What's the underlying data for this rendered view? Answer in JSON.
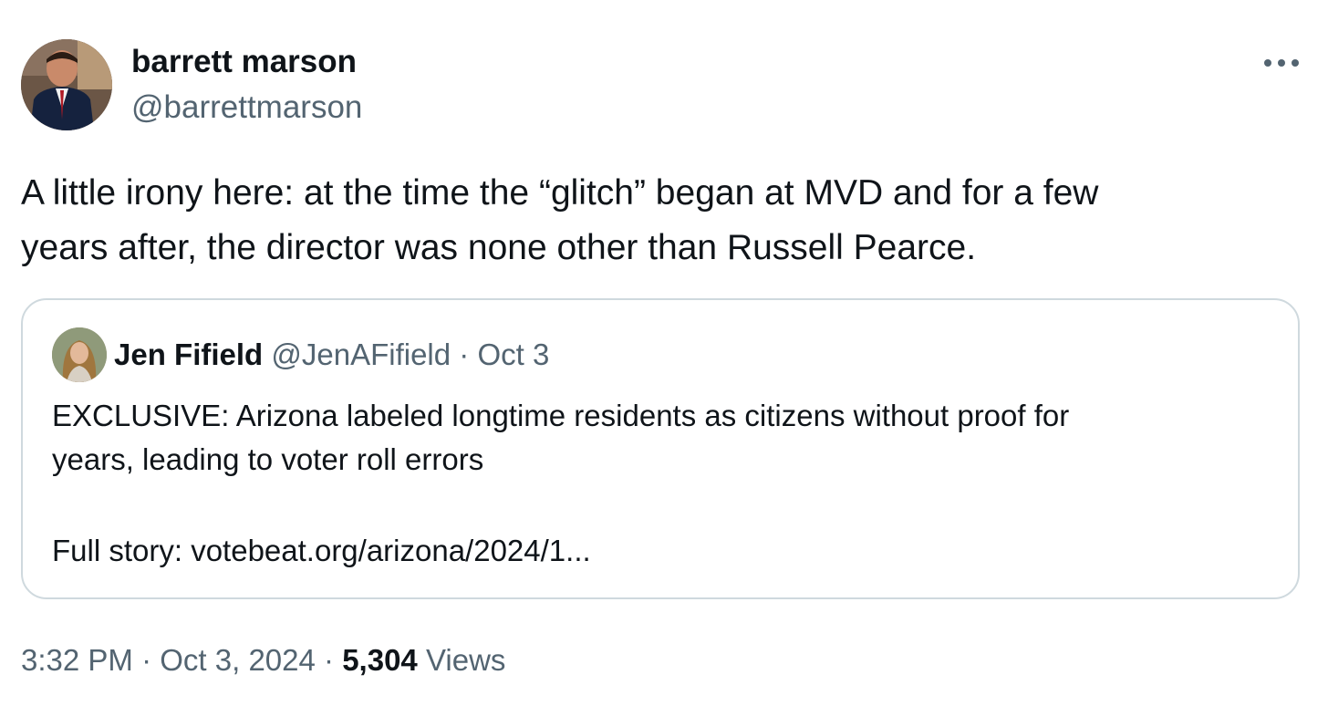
{
  "author": {
    "name": "barrett marson",
    "handle": "@barrettmarson",
    "avatar_icon": "profile-photo-man-in-suit"
  },
  "more_icon": "more-options-icon",
  "tweet": {
    "text_line1": "A little irony here: at the time the “glitch” began at MVD and for a few",
    "text_line2": "years after, the director was none other than Russell Pearce."
  },
  "quote": {
    "avatar_icon": "profile-photo-woman",
    "name": "Jen Fifield",
    "handle": "@JenAFifield",
    "separator": "·",
    "date": "Oct 3",
    "text_line1": "EXCLUSIVE: Arizona labeled longtime residents as citizens without proof for",
    "text_line2": "years, leading to voter roll errors",
    "link_line": "Full story: votebeat.org/arizona/2024/1..."
  },
  "meta": {
    "time": "3:32 PM",
    "sep1": "·",
    "date": "Oct 3, 2024",
    "sep2": "·",
    "views_count": "5,304",
    "views_label": "Views"
  },
  "colors": {
    "text_primary": "#0f1419",
    "text_secondary": "#536471",
    "border": "#cfd9de",
    "background": "#ffffff"
  }
}
